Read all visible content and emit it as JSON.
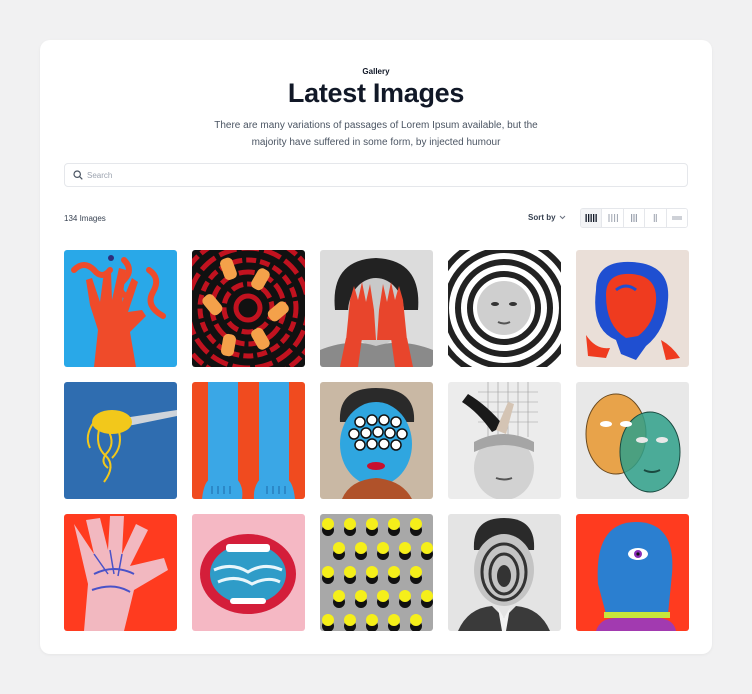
{
  "header": {
    "eyebrow": "Gallery",
    "title": "Latest Images",
    "subtitle": "There are many variations of passages of Lorem Ipsum available, but the majority have suffered in some form, by injected humour"
  },
  "search": {
    "placeholder": "Search",
    "value": ""
  },
  "toolbar": {
    "count_label": "134 Images",
    "sort_label": "Sort by",
    "views": [
      "view-5-columns",
      "view-4-columns",
      "view-3-columns",
      "view-2-columns",
      "view-list"
    ],
    "active_view": "view-5-columns"
  },
  "images": [
    {
      "name": "hand-snakes",
      "bg": "#29a8e8"
    },
    {
      "name": "fingers-maze",
      "bg": "#c1121f"
    },
    {
      "name": "woman-red-hands",
      "bg": "#d9d9d9"
    },
    {
      "name": "face-circles",
      "bg": "#ffffff"
    },
    {
      "name": "red-figure",
      "bg": "#eadfd8"
    },
    {
      "name": "spaghetti-fork",
      "bg": "#2f6db0"
    },
    {
      "name": "blue-legs",
      "bg": "#f04b1f"
    },
    {
      "name": "eyes-face",
      "bg": "#c9b8a4"
    },
    {
      "name": "legs-head-collage",
      "bg": "#e5e5e5"
    },
    {
      "name": "two-faces",
      "bg": "#e8e8e8"
    },
    {
      "name": "pink-hands",
      "bg": "#ff3b1f"
    },
    {
      "name": "ocean-mouth",
      "bg": "#f5b8c4"
    },
    {
      "name": "yellow-dots",
      "bg": "#a8a8a8"
    },
    {
      "name": "man-portal",
      "bg": "#e0e0e0"
    },
    {
      "name": "blue-head-eye",
      "bg": "#ff3b1f"
    }
  ]
}
